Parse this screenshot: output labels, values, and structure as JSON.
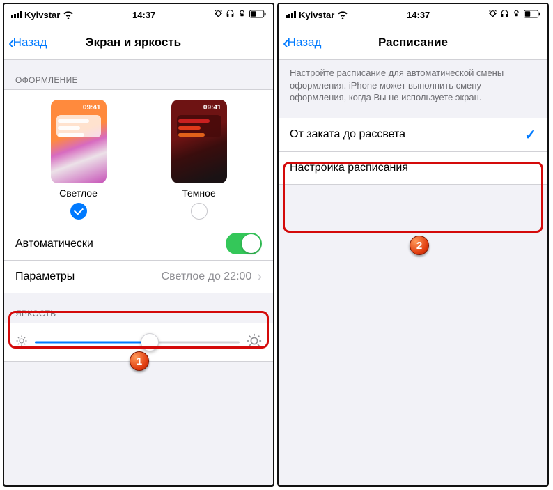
{
  "status": {
    "carrier": "Kyivstar",
    "time": "14:37"
  },
  "left": {
    "back": "Назад",
    "title": "Экран и яркость",
    "section_appearance": "ОФОРМЛЕНИЕ",
    "theme_light": "Светлое",
    "theme_dark": "Темное",
    "thumb_time": "09:41",
    "auto_label": "Автоматически",
    "params_label": "Параметры",
    "params_value": "Светлое до 22:00",
    "section_brightness": "ЯРКОСТЬ",
    "badge": "1"
  },
  "right": {
    "back": "Назад",
    "title": "Расписание",
    "footer": "Настройте расписание для автоматической смены оформления. iPhone может выполнить смену оформления, когда Вы не используете экран.",
    "option_sunset": "От заката до рассвета",
    "option_custom": "Настройка расписания",
    "badge": "2"
  }
}
